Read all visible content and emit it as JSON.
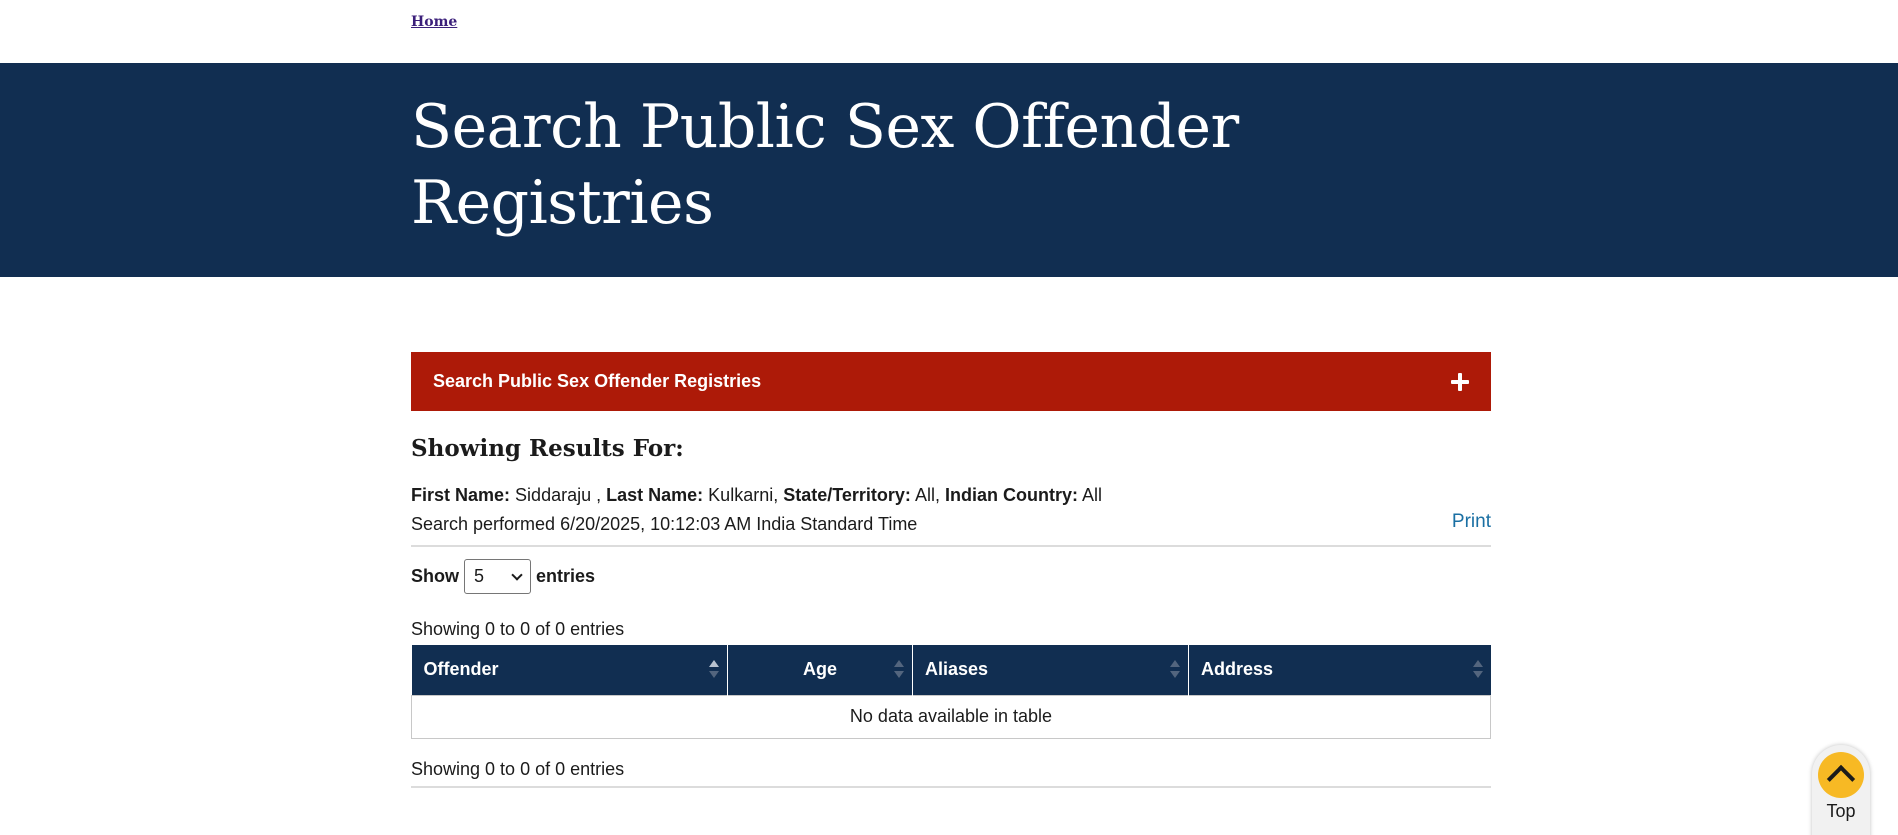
{
  "nav": {
    "home_label": "Home"
  },
  "hero": {
    "title_line1": "Search Public Sex Offender",
    "title_line2": "Registries"
  },
  "accordion": {
    "title": "Search Public Sex Offender Registries",
    "toggle_icon": "plus-icon"
  },
  "results": {
    "heading": "Showing Results For:",
    "first_name_label": "First Name:",
    "first_name_value": "Siddaraju ,",
    "last_name_label": "Last Name:",
    "last_name_value": "Kulkarni,",
    "state_label": "State/Territory:",
    "state_value": "All,",
    "country_label": "Indian Country:",
    "country_value": "All",
    "performed": "Search performed 6/20/2025, 10:12:03 AM India Standard Time",
    "print_label": "Print"
  },
  "length": {
    "show_label": "Show",
    "selected": "5",
    "entries_label": "entries"
  },
  "table": {
    "info_top": "Showing 0 to 0 of 0 entries",
    "columns": [
      "Offender",
      "Age",
      "Aliases",
      "Address"
    ],
    "empty_message": "No data available in table",
    "info_bottom": "Showing 0 to 0 of 0 entries"
  },
  "back_to_top": {
    "label": "Top",
    "icon": "chevron-up-icon",
    "accent": "#f7b924"
  },
  "colors": {
    "header_bg": "#112e51",
    "accordion_bg": "#ad1a08",
    "link": "#1a6fa3"
  }
}
